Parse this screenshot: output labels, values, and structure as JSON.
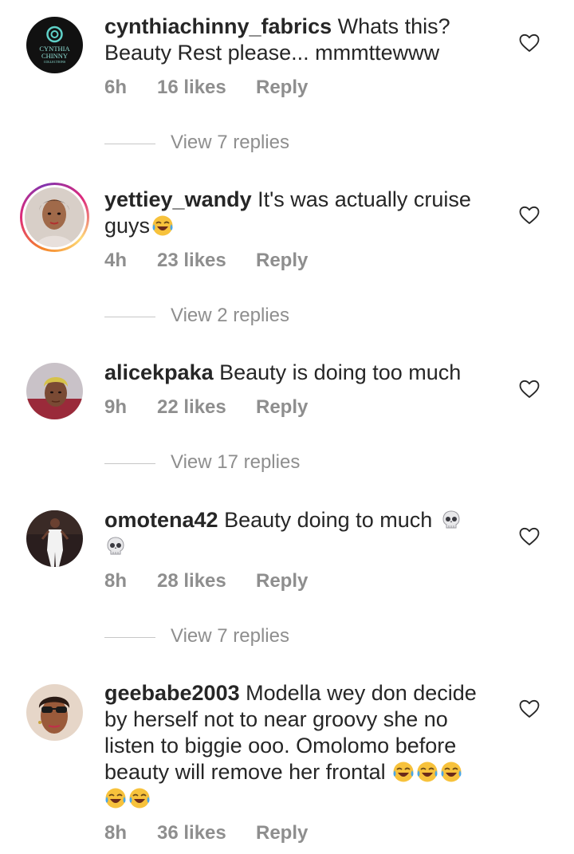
{
  "comments": [
    {
      "username": "cynthiachinny_fabrics",
      "text": "Whats this? Beauty Rest please... mmmttewww",
      "time": "6h",
      "likes": "16 likes",
      "reply": "Reply",
      "view_replies": "View 7 replies",
      "avatar_logo_line1": "CYNTHIA",
      "avatar_logo_line2": "CHINNY",
      "avatar_logo_line3": "COLLECTIONS"
    },
    {
      "username": "yettiey_wandy",
      "text": "It's was actually cruise guys",
      "emoji": [
        "face-with-tears-of-joy"
      ],
      "time": "4h",
      "likes": "23 likes",
      "reply": "Reply",
      "view_replies": "View 2 replies"
    },
    {
      "username": "alicekpaka",
      "text": "Beauty is doing too much",
      "time": "9h",
      "likes": "22 likes",
      "reply": "Reply",
      "view_replies": "View 17 replies"
    },
    {
      "username": "omotena42",
      "text": "Beauty doing to much",
      "emoji": [
        "skull",
        "skull"
      ],
      "time": "8h",
      "likes": "28 likes",
      "reply": "Reply",
      "view_replies": "View 7 replies"
    },
    {
      "username": "geebabe2003",
      "text": "Modella wey don decide by herself not to near groovy she no listen to biggie ooo. Omolomo before beauty will remove her frontal",
      "emoji": [
        "face-with-tears-of-joy",
        "face-with-tears-of-joy",
        "face-with-tears-of-joy",
        "face-with-tears-of-joy",
        "face-with-tears-of-joy"
      ],
      "time": "8h",
      "likes": "36 likes",
      "reply": "Reply"
    }
  ],
  "colors": {
    "text": "#262626",
    "meta": "#8e8e8e",
    "divider": "#c7c7c7",
    "story_ring_start": "#f58529",
    "story_ring_end": "#dd2a7b"
  },
  "icons": {
    "like": "heart-outline-icon"
  }
}
